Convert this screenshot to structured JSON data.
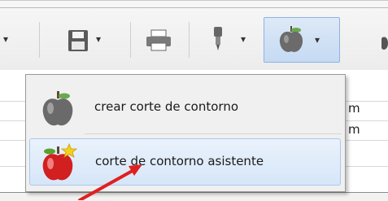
{
  "menu": {
    "items": [
      {
        "label": "crear corte de contorno",
        "icon": "apple-icon"
      },
      {
        "label": "corte de contorno asistente",
        "icon": "apple-wizard-icon"
      }
    ]
  },
  "document": {
    "rows": [
      "m",
      "m"
    ]
  },
  "colors": {
    "highlight": "#d6e6f8",
    "annotation_arrow": "#e02020"
  }
}
